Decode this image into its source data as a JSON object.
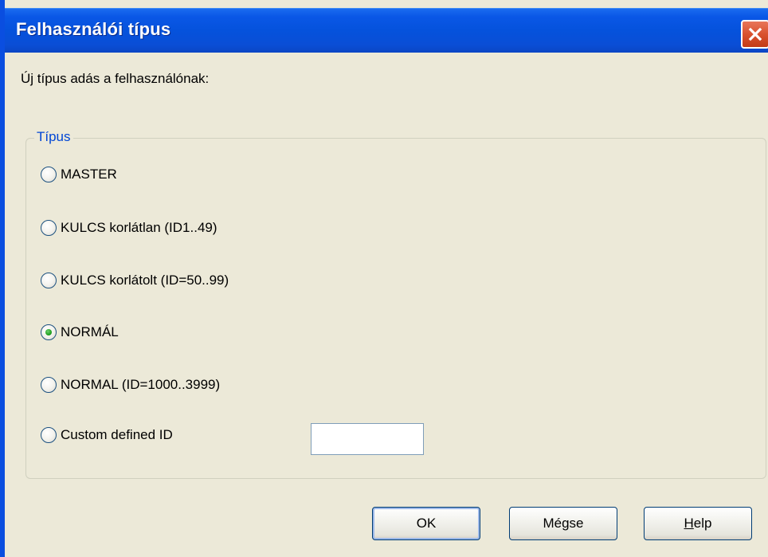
{
  "window": {
    "title": "Felhasználói típus",
    "close_icon": "close-icon"
  },
  "prompt": "Új típus adás a felhasználónak:",
  "group": {
    "legend": "Típus",
    "options": [
      {
        "label": "MASTER",
        "checked": false
      },
      {
        "label": "KULCS korlátlan (ID1..49)",
        "checked": false
      },
      {
        "label": "KULCS korlátolt (ID=50..99)",
        "checked": false
      },
      {
        "label": "NORMÁL",
        "checked": true
      },
      {
        "label": "NORMAL (ID=1000..3999)",
        "checked": false
      },
      {
        "label": "Custom defined ID",
        "checked": false
      }
    ],
    "custom_id_value": ""
  },
  "buttons": {
    "ok": "OK",
    "cancel": "Mégse",
    "help_first": "H",
    "help_rest": "elp"
  },
  "colors": {
    "title_bar": "#0552dc",
    "close_button": "#d9522f",
    "legend_text": "#0046d5",
    "dialog_bg": "#ece9d8",
    "radio_checked": "#21a121"
  }
}
